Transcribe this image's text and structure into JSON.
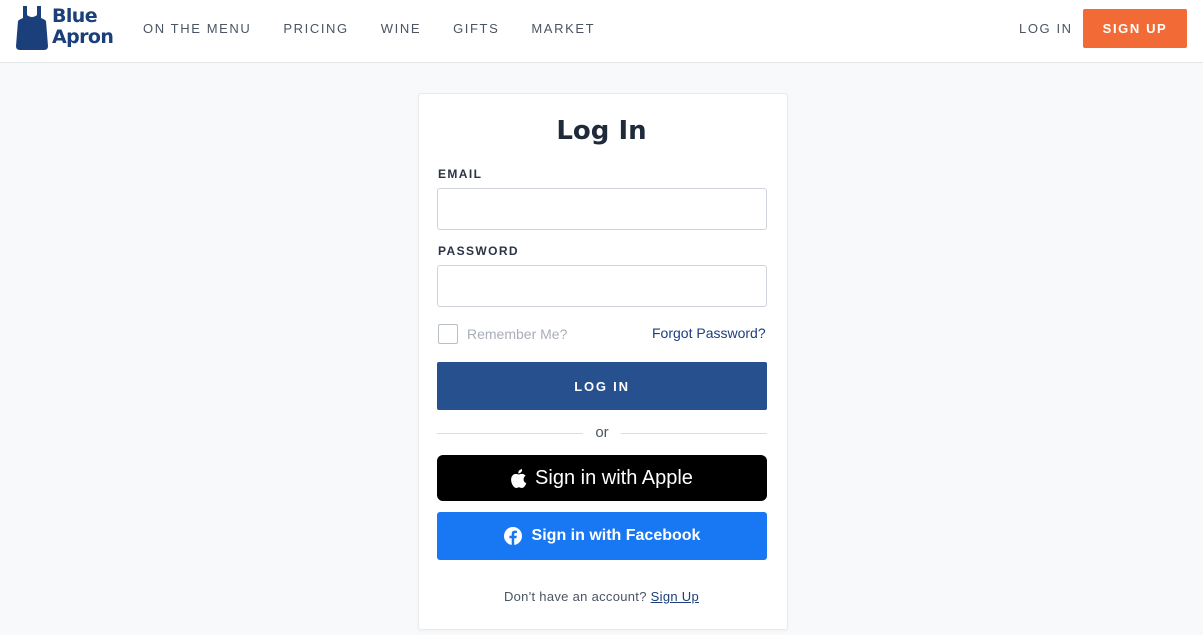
{
  "brand": {
    "name_line1": "Blue",
    "name_line2": "Apron",
    "logo_icon": "apron-icon",
    "color": "#1b3f7a"
  },
  "nav": {
    "items": [
      "ON THE MENU",
      "PRICING",
      "WINE",
      "GIFTS",
      "MARKET"
    ],
    "login_label": "LOG IN",
    "signup_label": "SIGN UP",
    "signup_color": "#f26b36"
  },
  "form": {
    "title": "Log In",
    "email_label": "EMAIL",
    "email_value": "",
    "password_label": "PASSWORD",
    "password_value": "",
    "remember_label": "Remember Me?",
    "remember_checked": false,
    "forgot_label": "Forgot Password?",
    "submit_label": "LOG IN",
    "submit_color": "#27508f",
    "divider_text": "or",
    "apple_label": "Sign in with Apple",
    "apple_icon": "apple-icon",
    "facebook_label": "Sign in with Facebook",
    "facebook_icon": "facebook-icon",
    "facebook_color": "#1877f2",
    "no_account_text": "Don't have an account?",
    "signup_link_label": "Sign Up"
  }
}
